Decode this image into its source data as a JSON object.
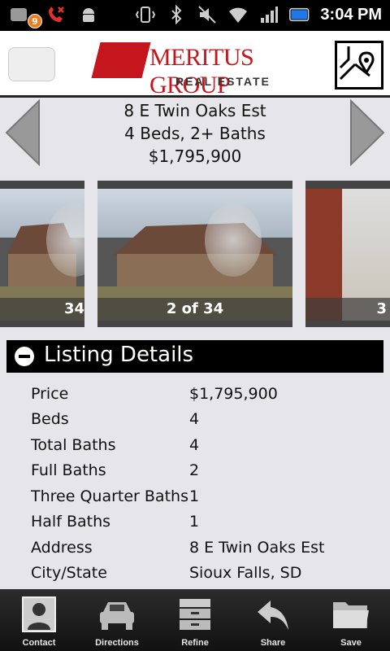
{
  "status_bar": {
    "notification_count": "9",
    "time": "3:04 PM"
  },
  "header": {
    "logo": {
      "brand": "MERITUS GROUP",
      "subtitle": "REAL ESTATE"
    }
  },
  "listing_summary": {
    "address": "8 E Twin Oaks Est",
    "beds_baths": "4 Beds, 2+ Baths",
    "price": "$1,795,900"
  },
  "gallery": {
    "prev_caption": "34",
    "current_caption": "2 of 34",
    "next_caption": "3"
  },
  "listing_details": {
    "title": "Listing Details",
    "rows": [
      {
        "label": "Price",
        "value": "$1,795,900"
      },
      {
        "label": "Beds",
        "value": "4"
      },
      {
        "label": "Total Baths",
        "value": "4"
      },
      {
        "label": "Full Baths",
        "value": "2"
      },
      {
        "label": "Three Quarter Baths",
        "value": "1"
      },
      {
        "label": "Half Baths",
        "value": "1"
      },
      {
        "label": "Address",
        "value": "8 E Twin Oaks Est"
      },
      {
        "label": "City/State",
        "value": "Sioux Falls, SD"
      }
    ]
  },
  "bottom_bar": {
    "tabs": [
      {
        "label": "Contact",
        "icon": "contact-icon"
      },
      {
        "label": "Directions",
        "icon": "car-icon"
      },
      {
        "label": "Refine",
        "icon": "filter-icon"
      },
      {
        "label": "Share",
        "icon": "share-icon"
      },
      {
        "label": "Save",
        "icon": "folder-icon"
      }
    ]
  },
  "colors": {
    "brand_red": "#c4161c",
    "background": "#e6e6ea",
    "header_bar": "#000000"
  }
}
